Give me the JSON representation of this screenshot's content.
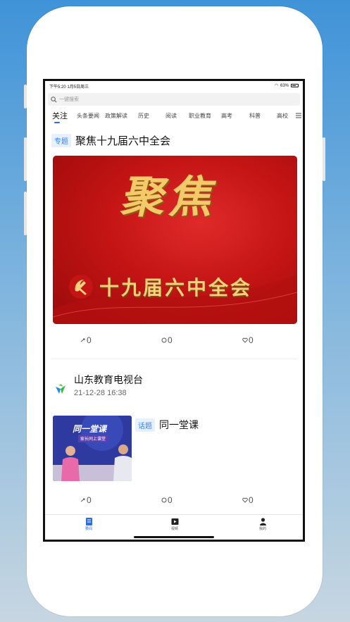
{
  "status_bar": {
    "time": "下午5:20  1月5日周三",
    "battery": "63%"
  },
  "search": {
    "placeholder": "一键搜索"
  },
  "tabs": [
    "关注",
    "头条要闻",
    "政策解读",
    "历史",
    "阅读",
    "职业教育",
    "高考",
    "科普",
    "高校"
  ],
  "card1": {
    "tag": "专题",
    "title": "聚焦十九届六中全会",
    "banner_big": "聚焦",
    "banner_sub": "十九届六中全会",
    "shares": "0",
    "comments": "0",
    "likes": "0"
  },
  "card2": {
    "channel": "山东教育电视台",
    "time": "21-12-28 16:38",
    "tag": "话题",
    "title": "同一堂课",
    "thumb_title": "同一堂课",
    "thumb_sub": "家长同上课堂",
    "shares": "0",
    "comments": "0",
    "likes": "0"
  },
  "bottom_nav": [
    {
      "label": "要闻",
      "icon": "news-icon"
    },
    {
      "label": "视频",
      "icon": "video-icon"
    },
    {
      "label": "我的",
      "icon": "profile-icon"
    }
  ],
  "colors": {
    "accent": "#2b6fe0",
    "tag_bg": "#e6f0ff",
    "banner_red": "#c41414",
    "gold": "#f4c96a"
  }
}
